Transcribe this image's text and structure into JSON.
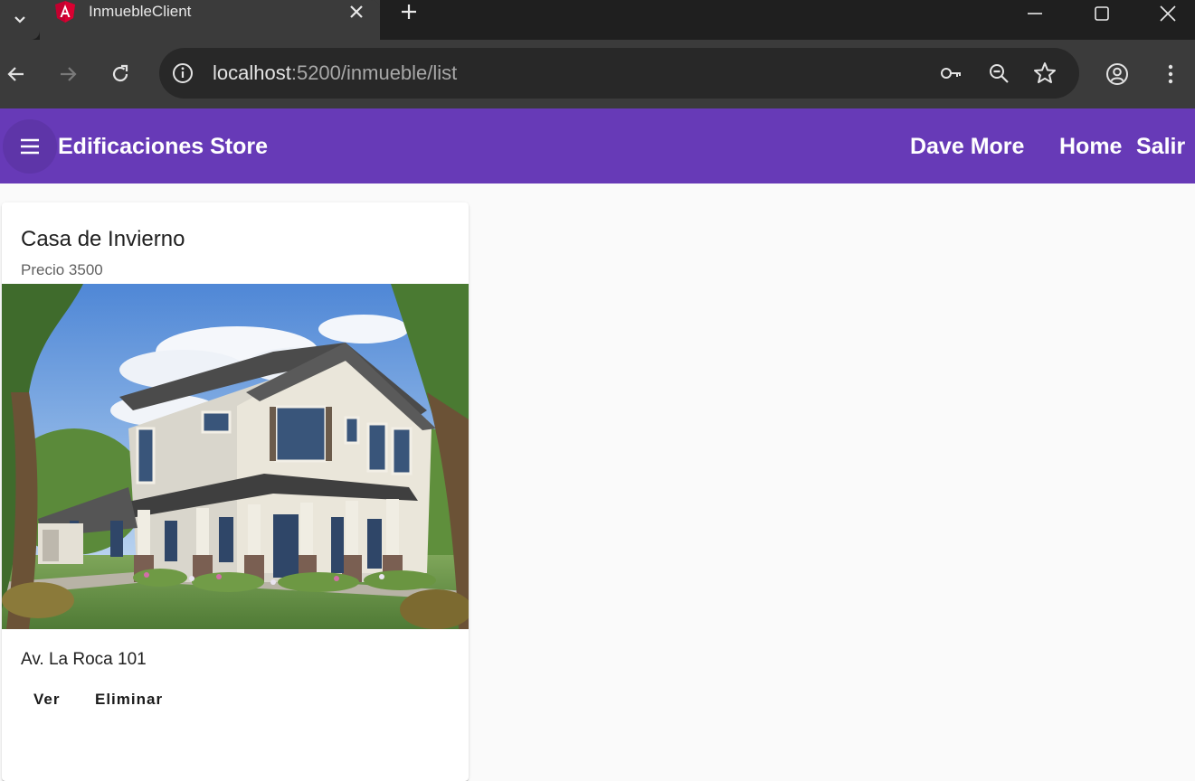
{
  "browser": {
    "tab_title": "InmuebleClient",
    "url_host": "localhost",
    "url_rest": ":5200/inmueble/list",
    "icons": {
      "tab_menu": "chevron-down-icon",
      "favicon": "angular-icon",
      "tab_close": "close-icon",
      "new_tab": "plus-icon",
      "minimize": "minimize-icon",
      "maximize": "maximize-icon",
      "close_window": "close-window-icon",
      "back": "back-arrow-icon",
      "forward": "forward-arrow-icon",
      "reload": "reload-icon",
      "site_info": "info-icon",
      "password": "key-icon",
      "zoom": "zoom-out-icon",
      "bookmark": "star-icon",
      "profile": "profile-icon",
      "more": "more-vert-icon"
    }
  },
  "app_bar": {
    "title": "Edificaciones Store",
    "user_name": "Dave More",
    "home_label": "Home",
    "logout_label": "Salir",
    "color": "#673ab7"
  },
  "card": {
    "title": "Casa de Invierno",
    "subtitle": "Precio 3500",
    "address": "Av. La Roca 101",
    "view_label": "Ver",
    "delete_label": "Eliminar"
  }
}
